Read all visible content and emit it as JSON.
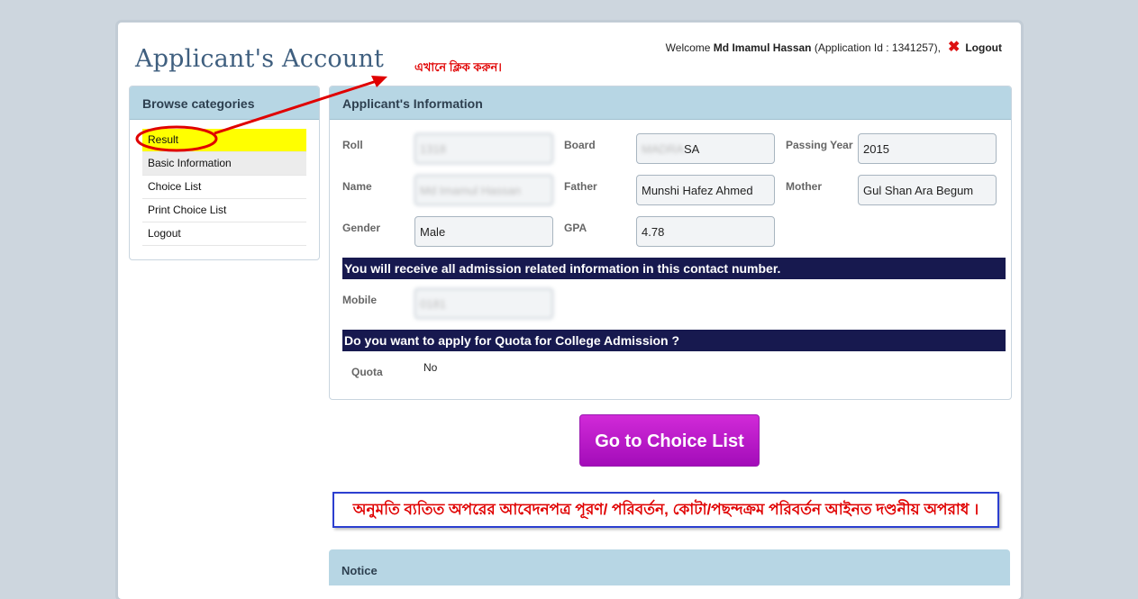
{
  "header": {
    "title": "Applicant's Account",
    "welcome_prefix": "Welcome",
    "user_name": "Md Imamul Hassan",
    "application_text": "(Application Id : 1341257),",
    "logout_label": "Logout"
  },
  "annotation": {
    "text": "এখানে ক্লিক করুন।",
    "color": "#e00000"
  },
  "sidebar": {
    "title": "Browse categories",
    "items": [
      {
        "label": "Result"
      },
      {
        "label": "Basic Information"
      },
      {
        "label": "Choice List"
      },
      {
        "label": "Print Choice List"
      },
      {
        "label": "Logout"
      }
    ]
  },
  "applicant": {
    "title": "Applicant's Information",
    "labels": {
      "roll": "Roll",
      "board": "Board",
      "passing_year": "Passing Year",
      "name": "Name",
      "father": "Father",
      "mother": "Mother",
      "gender": "Gender",
      "gpa": "GPA",
      "mobile": "Mobile",
      "quota": "Quota"
    },
    "values": {
      "roll": "1318",
      "board": "MADRASA",
      "passing_year": "2015",
      "name": "Md Imamul Hassan",
      "father": "Munshi Hafez Ahmed",
      "mother": "Gul Shan Ara Begum",
      "gender": "Male",
      "gpa": "4.78",
      "mobile": "0181",
      "quota": "No"
    },
    "contact_banner": "You will receive all admission related information in this contact number.",
    "quota_banner": "Do you want to apply for Quota for College Admission ?"
  },
  "actions": {
    "choice_button": "Go to Choice List"
  },
  "warning": {
    "text": "অনুমতি ব্যতিত অপরের আবেদনপত্র পূরণ/ পরিবর্তন, কোটা/পছন্দক্রম পরিবর্তন আইনত দণ্ডনীয় অপরাধ ।"
  },
  "notice": {
    "title": "Notice"
  },
  "colors": {
    "banner_bg": "#17194f",
    "panel_head_bg": "#b7d6e4",
    "active_item_bg": "#ffff00",
    "button_bg": "#c21ccd"
  }
}
